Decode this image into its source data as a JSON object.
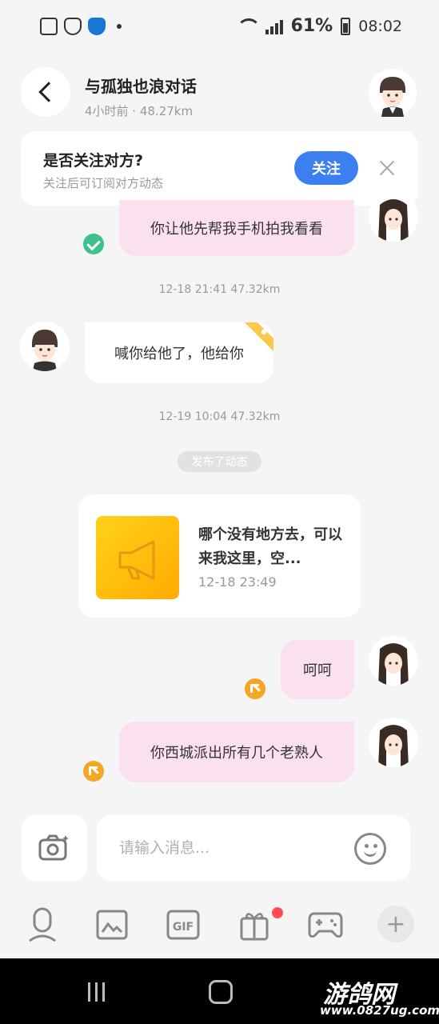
{
  "status_bar": {
    "battery": "61%",
    "time": "08:02"
  },
  "header": {
    "title": "与孤独也浪对话",
    "subtitle": "4小时前 · 48.27km"
  },
  "follow_prompt": {
    "title": "是否关注对方?",
    "subtitle": "关注后可订阅对方动态",
    "button": "关注"
  },
  "messages": [
    {
      "from": "me",
      "text": "你让他先帮我手机拍我看看",
      "status": "sent"
    },
    {
      "timestamp": "12-18 21:41  47.32km"
    },
    {
      "from": "them",
      "text": "喊你给他了，他给你"
    },
    {
      "timestamp": "12-19 10:04  47.32km"
    },
    {
      "from": "me",
      "text": "呵呵",
      "status": "pending"
    },
    {
      "from": "me",
      "text": "你西城派出所有几个老熟人",
      "status": "pending"
    }
  ],
  "post": {
    "pill": "发布了动态",
    "text": "哪个没有地方去，可以来我这里，空...",
    "time": "12-18 23:49"
  },
  "input": {
    "placeholder": "请输入消息..."
  },
  "toolbar": {
    "items": [
      "voice-icon",
      "image-icon",
      "gif-icon",
      "gift-icon",
      "game-icon",
      "plus-icon"
    ],
    "gif_label": "GIF",
    "gift_badge_color": "#ff4d4f"
  },
  "watermark": {
    "title": "游鸽网",
    "url": "www.0827ug.com"
  },
  "colors": {
    "accent": "#3b7ff0",
    "my_bubble": "#fbe1ef",
    "sent_check": "#3ec28d",
    "pending": "#f5a623"
  }
}
